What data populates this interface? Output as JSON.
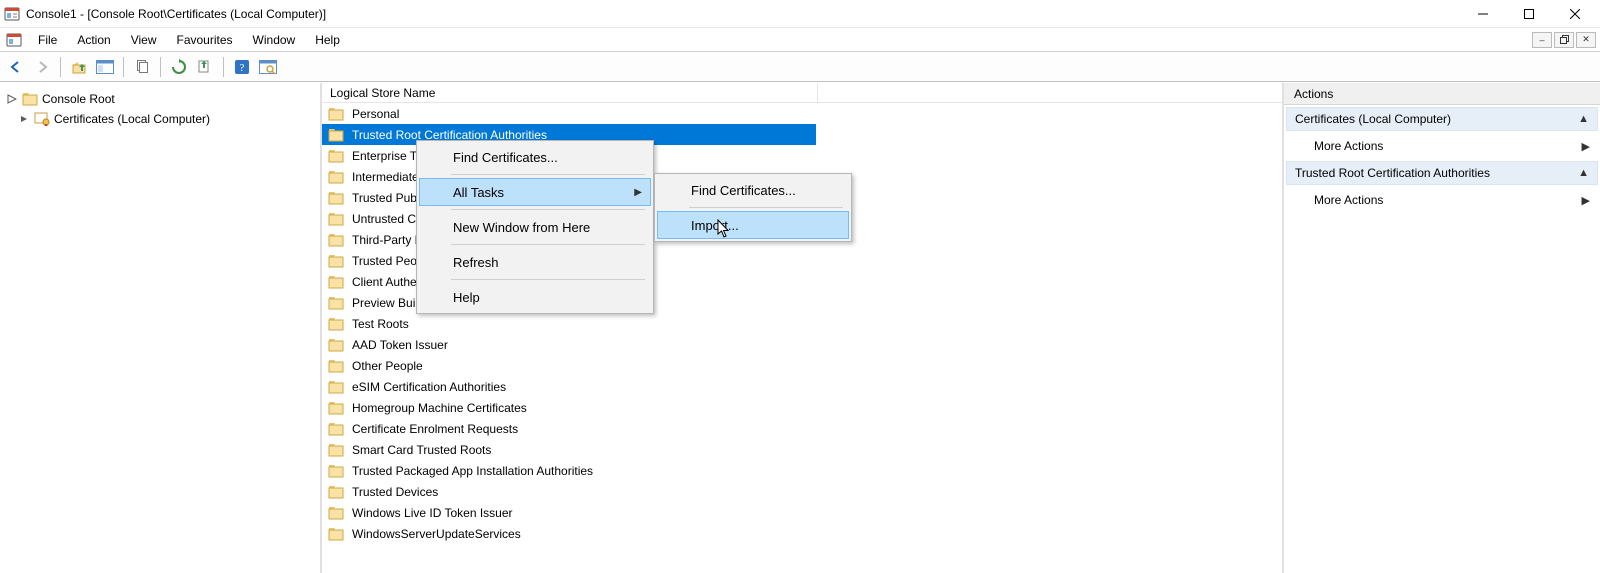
{
  "window": {
    "title": "Console1 - [Console Root\\Certificates (Local Computer)]"
  },
  "menu": {
    "file": "File",
    "action": "Action",
    "view": "View",
    "favourites": "Favourites",
    "window": "Window",
    "help": "Help"
  },
  "tree": {
    "root": "Console Root",
    "certs": "Certificates (Local Computer)"
  },
  "list": {
    "header": "Logical Store Name",
    "items": [
      "Personal",
      "Trusted Root Certification Authorities",
      "Enterprise Trust",
      "Intermediate Certification Authorities",
      "Trusted Publishers",
      "Untrusted Certificates",
      "Third-Party Root Certification Authorities",
      "Trusted People",
      "Client Authentication Issuers",
      "Preview Build Roots",
      "Test Roots",
      "AAD Token Issuer",
      "Other People",
      "eSIM Certification Authorities",
      "Homegroup Machine Certificates",
      "Certificate Enrolment Requests",
      "Smart Card Trusted Roots",
      "Trusted Packaged App Installation Authorities",
      "Trusted Devices",
      "Windows Live ID Token Issuer",
      "WindowsServerUpdateServices"
    ],
    "selected_index": 1
  },
  "context_menu": {
    "find_certs": "Find Certificates...",
    "all_tasks": "All Tasks",
    "new_window": "New Window from Here",
    "refresh": "Refresh",
    "help": "Help"
  },
  "submenu": {
    "find_certs": "Find Certificates...",
    "import": "Import..."
  },
  "actions": {
    "header": "Actions",
    "section1": "Certificates (Local Computer)",
    "more1": "More Actions",
    "section2": "Trusted Root Certification Authorities",
    "more2": "More Actions"
  }
}
